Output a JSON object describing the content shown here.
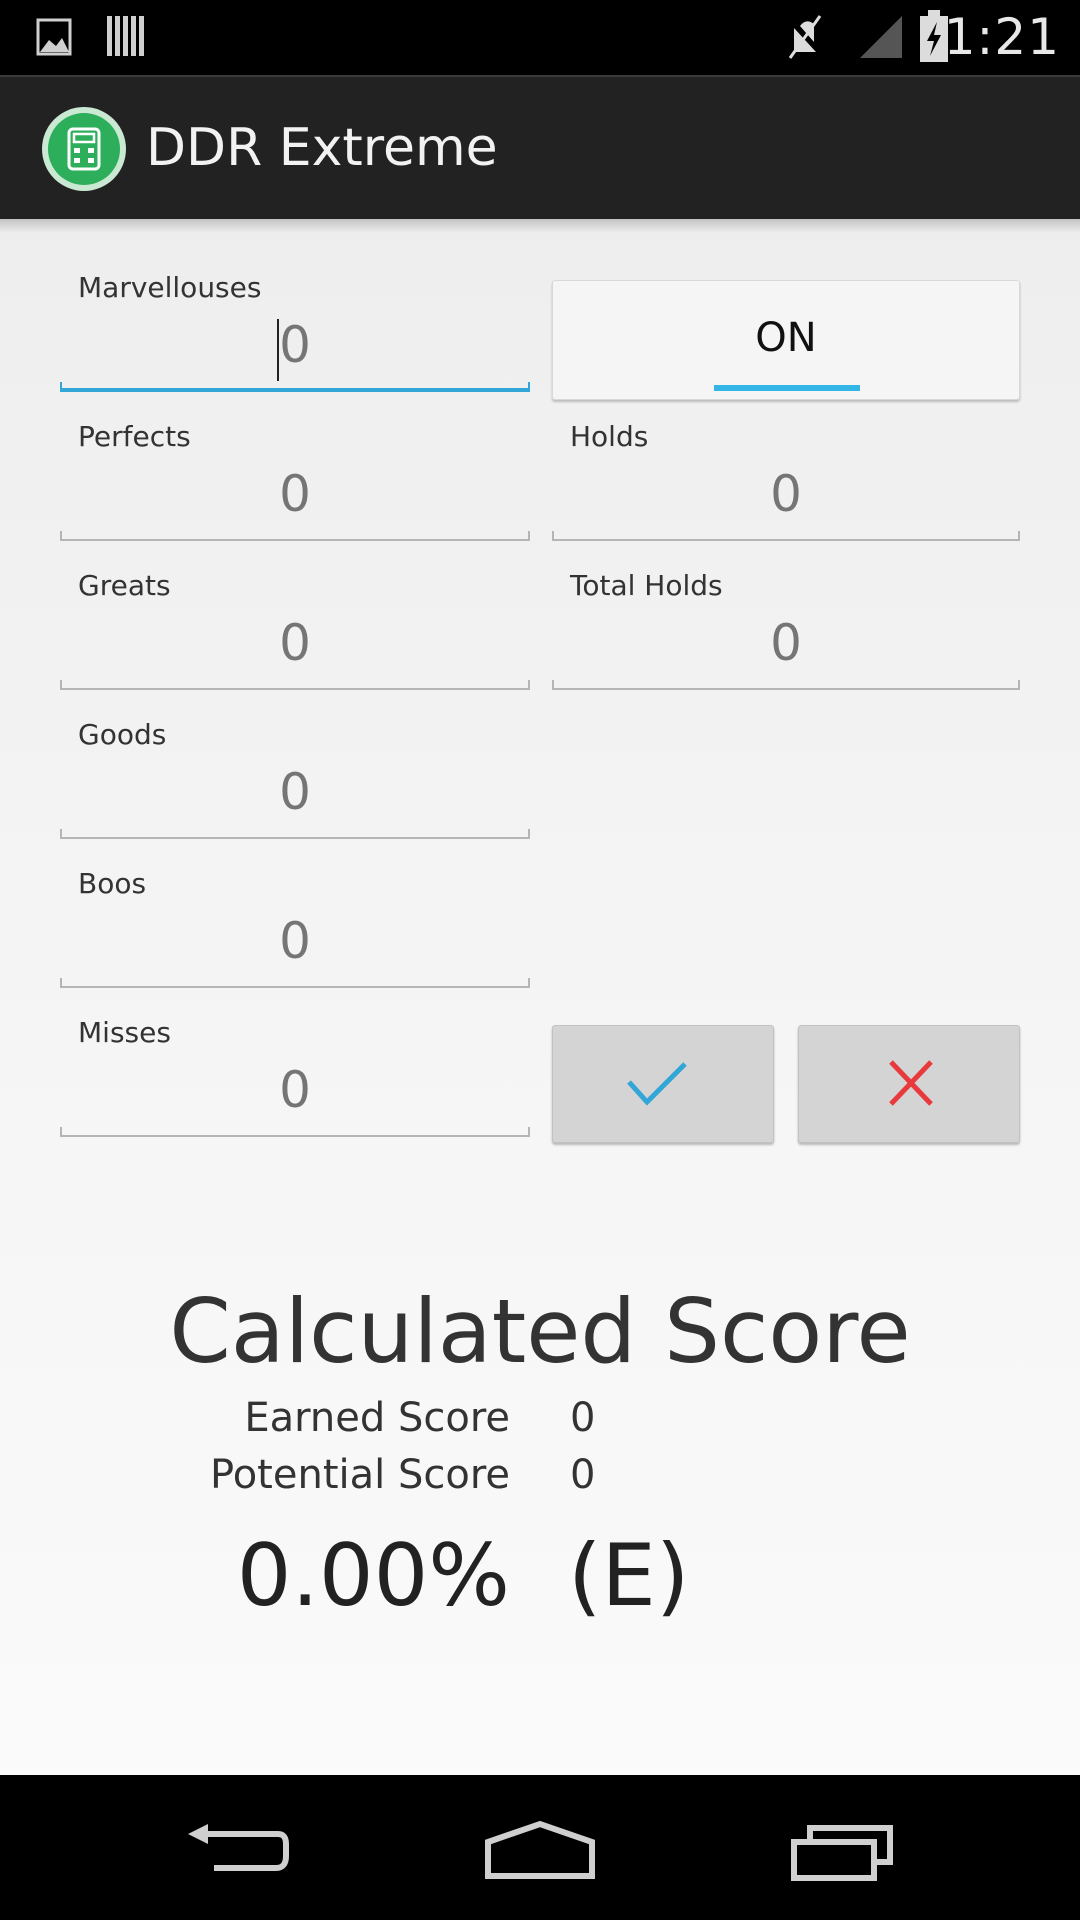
{
  "status_bar": {
    "time": "1:21",
    "icons": [
      "image-icon",
      "barcode-icon",
      "mute-icon",
      "signal-icon",
      "battery-charging-icon"
    ]
  },
  "action_bar": {
    "title": "DDR Extreme",
    "icon": "calculator-icon"
  },
  "fields": {
    "marvellouses": {
      "label": "Marvellouses",
      "value": "0"
    },
    "perfects": {
      "label": "Perfects",
      "value": "0"
    },
    "greats": {
      "label": "Greats",
      "value": "0"
    },
    "goods": {
      "label": "Goods",
      "value": "0"
    },
    "boos": {
      "label": "Boos",
      "value": "0"
    },
    "misses": {
      "label": "Misses",
      "value": "0"
    },
    "holds": {
      "label": "Holds",
      "value": "0"
    },
    "total_holds": {
      "label": "Total Holds",
      "value": "0"
    }
  },
  "toggle": {
    "label": "ON",
    "state": "on"
  },
  "buttons": {
    "confirm_icon": "check-icon",
    "clear_icon": "close-icon"
  },
  "score": {
    "title": "Calculated Score",
    "earned_label": "Earned Score",
    "earned_value": "0",
    "potential_label": "Potential Score",
    "potential_value": "0",
    "percent": "0.00%",
    "grade": "(E)"
  },
  "nav_bar": {
    "icons": [
      "back-icon",
      "home-icon",
      "recents-icon"
    ]
  },
  "colors": {
    "accent": "#33b5e5",
    "app_icon": "#2dae5b",
    "clear_red": "#e8393c",
    "action_bar": "#222222"
  }
}
